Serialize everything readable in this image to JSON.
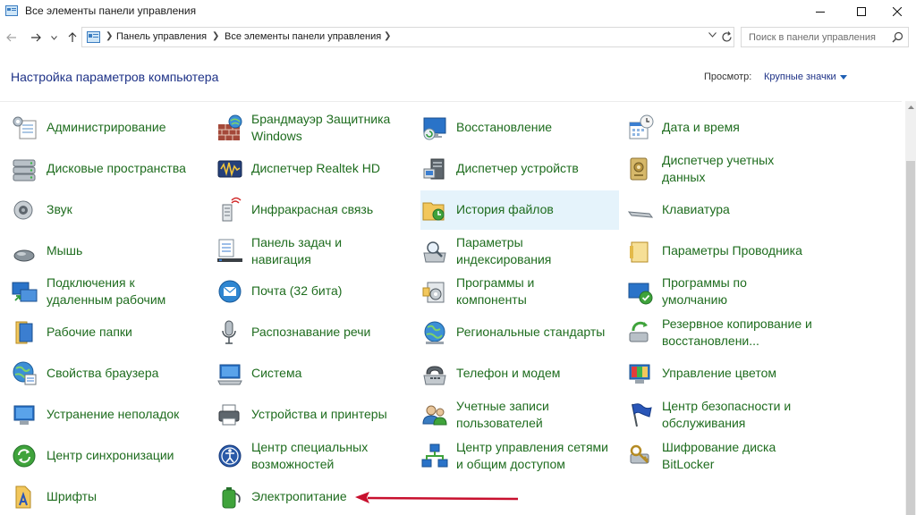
{
  "window": {
    "title": "Все элементы панели управления"
  },
  "address": {
    "crumbs": [
      "Панель управления",
      "Все элементы панели управления"
    ]
  },
  "search": {
    "placeholder": "Поиск в панели управления"
  },
  "header": {
    "title": "Настройка параметров компьютера",
    "view_label": "Просмотр:",
    "view_value": "Крупные значки"
  },
  "items": [
    {
      "label": "Администрирование",
      "icon": "admin-tools-icon"
    },
    {
      "label": "Брандмауэр Защитника\nWindows",
      "icon": "firewall-icon"
    },
    {
      "label": "Восстановление",
      "icon": "recovery-icon"
    },
    {
      "label": "Дата и время",
      "icon": "date-time-icon"
    },
    {
      "label": "Дисковые пространства",
      "icon": "storage-spaces-icon"
    },
    {
      "label": "Диспетчер Realtek HD",
      "icon": "realtek-icon"
    },
    {
      "label": "Диспетчер устройств",
      "icon": "device-manager-icon"
    },
    {
      "label": "Диспетчер учетных\nданных",
      "icon": "credential-manager-icon"
    },
    {
      "label": "Звук",
      "icon": "sound-icon"
    },
    {
      "label": "Инфракрасная связь",
      "icon": "infrared-icon"
    },
    {
      "label": "История файлов",
      "icon": "file-history-icon"
    },
    {
      "label": "Клавиатура",
      "icon": "keyboard-icon"
    },
    {
      "label": "Мышь",
      "icon": "mouse-icon"
    },
    {
      "label": "Панель задач и\nнавигация",
      "icon": "taskbar-icon"
    },
    {
      "label": "Параметры\nиндексирования",
      "icon": "indexing-icon"
    },
    {
      "label": "Параметры Проводника",
      "icon": "explorer-options-icon"
    },
    {
      "label": "Подключения к\nудаленным рабочим",
      "icon": "remote-desktop-icon"
    },
    {
      "label": "Почта (32 бита)",
      "icon": "mail-icon"
    },
    {
      "label": "Программы и\nкомпоненты",
      "icon": "programs-icon"
    },
    {
      "label": "Программы по\nумолчанию",
      "icon": "default-programs-icon"
    },
    {
      "label": "Рабочие папки",
      "icon": "work-folders-icon"
    },
    {
      "label": "Распознавание речи",
      "icon": "microphone-icon"
    },
    {
      "label": "Региональные стандарты",
      "icon": "region-icon"
    },
    {
      "label": "Резервное копирование и\nвосстановлени...",
      "icon": "backup-icon"
    },
    {
      "label": "Свойства браузера",
      "icon": "internet-options-icon"
    },
    {
      "label": "Система",
      "icon": "system-icon"
    },
    {
      "label": "Телефон и модем",
      "icon": "phone-modem-icon"
    },
    {
      "label": "Управление цветом",
      "icon": "color-management-icon"
    },
    {
      "label": "Устранение неполадок",
      "icon": "troubleshooting-icon"
    },
    {
      "label": "Устройства и принтеры",
      "icon": "printer-icon"
    },
    {
      "label": "Учетные записи\nпользователей",
      "icon": "user-accounts-icon"
    },
    {
      "label": "Центр безопасности и\nобслуживания",
      "icon": "flag-icon"
    },
    {
      "label": "Центр синхронизации",
      "icon": "sync-icon"
    },
    {
      "label": "Центр специальных\nвозможностей",
      "icon": "accessibility-icon"
    },
    {
      "label": "Центр управления сетями\nи общим доступом",
      "icon": "network-icon"
    },
    {
      "label": "Шифрование диска\nBitLocker",
      "icon": "bitlocker-icon"
    },
    {
      "label": "Шрифты",
      "icon": "fonts-icon"
    },
    {
      "label": "Электропитание",
      "icon": "power-options-icon"
    }
  ],
  "colors": {
    "link_green": "#1e6c1e",
    "title_blue": "#1e3287",
    "hover_bg": "#e5f3fb",
    "arrow_red": "#c8102e"
  }
}
